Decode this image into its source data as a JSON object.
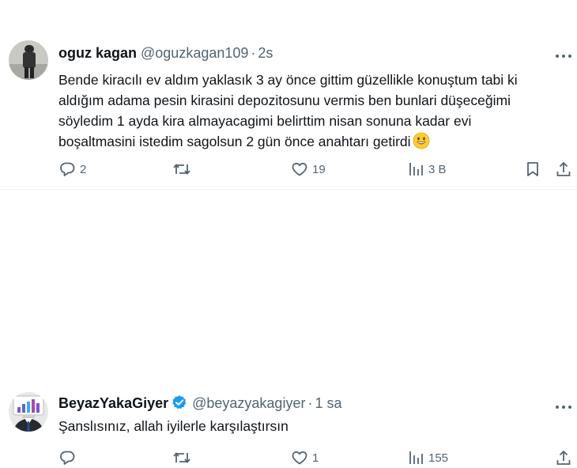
{
  "tweets": [
    {
      "display_name": "oguz kagan",
      "handle": "@oguzkagan109",
      "separator": "·",
      "time": "2s",
      "verified": false,
      "text": "Bende kiracılı ev aldım yaklasık 3 ay önce gittim güzellikle konuştum tabi ki\naldığım adama pesin kirasini depozitosunu vermis ben bunlari düşeceğimi\nsöyledim 1 ayda kira almayacagimi belirttim nisan sonuna kadar evi\nboşaltmasini istedim sagolsun 2 gün önce anahtarı getirdi",
      "emoji": "grinning-face",
      "replies": "2",
      "retweets": "",
      "likes": "19",
      "views": "3 B"
    },
    {
      "display_name": "BeyazYakaGiyer",
      "handle": "@beyazyakagiyer",
      "separator": "·",
      "time": "1 sa",
      "verified": true,
      "verified_color": "#1d9bf0",
      "text": "Şanslısınız, allah iyilerle karşılaştırsın",
      "replies": "",
      "retweets": "",
      "likes": "1",
      "views": "155"
    }
  ],
  "icons": {
    "reply": "reply-icon",
    "retweet": "retweet-icon",
    "like": "heart-icon",
    "views": "views-icon",
    "bookmark": "bookmark-icon",
    "share": "share-icon",
    "more": "more-icon"
  },
  "colors": {
    "text": "#0f1419",
    "secondary": "#536471",
    "divider": "#eff3f4",
    "verified": "#1d9bf0"
  }
}
